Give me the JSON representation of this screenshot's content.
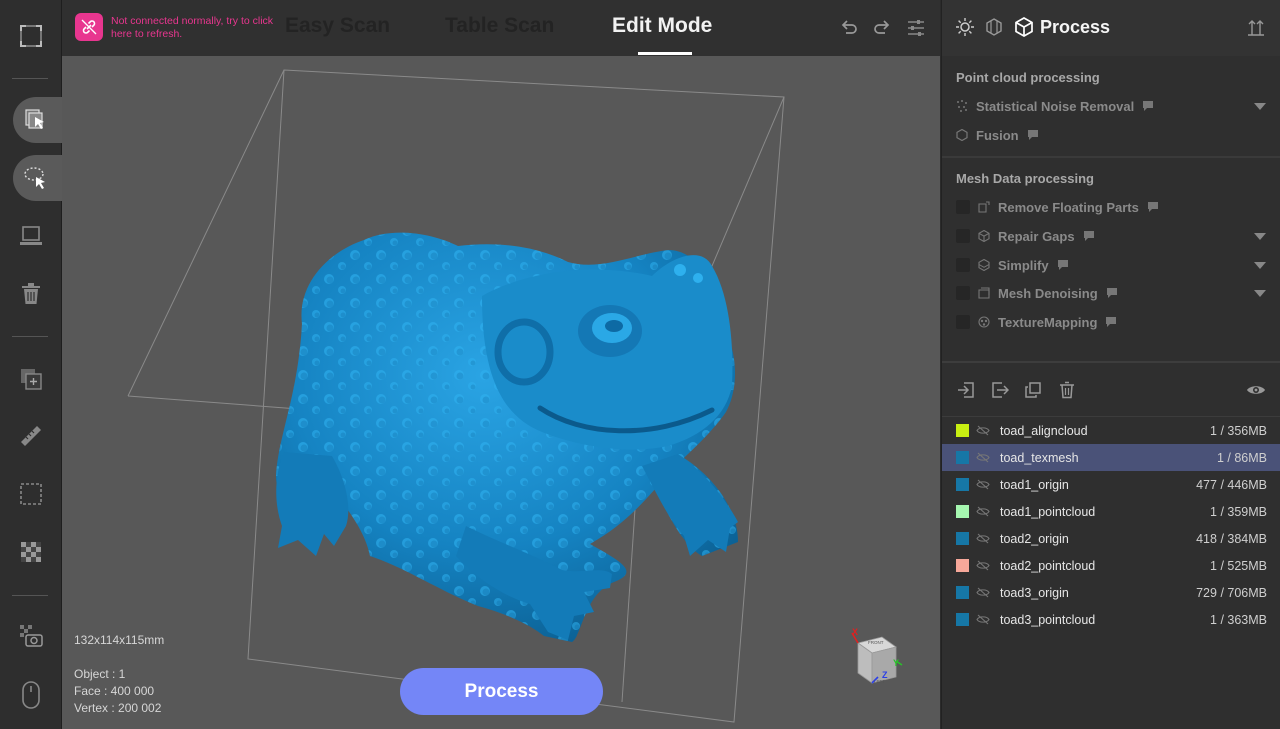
{
  "colors": {
    "accent": "#7486f7",
    "warning": "#e8368f",
    "model": "#1a86c4",
    "selected_row": "#4a5278"
  },
  "left_toolbar": {
    "icons": [
      "fullscreen-icon",
      "select-cursor-icon",
      "lasso-select-icon",
      "laptop-icon",
      "trash-icon",
      "add-layer-icon",
      "ruler-icon",
      "crop-frame-icon",
      "checkerboard-texture-icon",
      "camera-texture-icon",
      "mouse-icon"
    ]
  },
  "header": {
    "warning_text": "Not connected normally, try to click here to refresh.",
    "tabs": [
      {
        "label": "Easy Scan",
        "active": false
      },
      {
        "label": "Table Scan",
        "active": false
      },
      {
        "label": "Edit Mode",
        "active": true
      }
    ],
    "icons": [
      "undo-icon",
      "redo-icon",
      "settings-sliders-icon"
    ]
  },
  "viewport": {
    "dimensions": "132x114x115mm",
    "object": "Object : 1",
    "face": "Face : 400 000",
    "vertex": "Vertex : 200 002",
    "process_button": "Process",
    "axis": {
      "x": "X",
      "y": "Y",
      "z": "Z",
      "top": "FRONT",
      "side": "LEFT"
    }
  },
  "panel": {
    "title": "Process",
    "point_cloud_title": "Point cloud processing",
    "point_cloud_items": [
      {
        "label": "Statistical Noise Removal",
        "has_dropdown": true
      },
      {
        "label": "Fusion",
        "has_dropdown": false
      }
    ],
    "mesh_title": "Mesh Data processing",
    "mesh_items": [
      {
        "label": "Remove Floating Parts",
        "has_dropdown": false
      },
      {
        "label": "Repair Gaps",
        "has_dropdown": true
      },
      {
        "label": "Simplify",
        "has_dropdown": true
      },
      {
        "label": "Mesh Denoising",
        "has_dropdown": true
      },
      {
        "label": "TextureMapping",
        "has_dropdown": false
      }
    ]
  },
  "layers": [
    {
      "name": "toad_aligncloud",
      "size": "1 / 356MB",
      "color": "#c8ef12",
      "selected": false
    },
    {
      "name": "toad_texmesh",
      "size": "1 / 86MB",
      "color": "#1677a6",
      "selected": true
    },
    {
      "name": "toad1_origin",
      "size": "477 / 446MB",
      "color": "#1677a6",
      "selected": false
    },
    {
      "name": "toad1_pointcloud",
      "size": "1 / 359MB",
      "color": "#a6f7b0",
      "selected": false
    },
    {
      "name": "toad2_origin",
      "size": "418 / 384MB",
      "color": "#1677a6",
      "selected": false
    },
    {
      "name": "toad2_pointcloud",
      "size": "1 / 525MB",
      "color": "#f7a89a",
      "selected": false
    },
    {
      "name": "toad3_origin",
      "size": "729 / 706MB",
      "color": "#1677a6",
      "selected": false
    },
    {
      "name": "toad3_pointcloud",
      "size": "1 / 363MB",
      "color": "#1677a6",
      "selected": false
    }
  ]
}
